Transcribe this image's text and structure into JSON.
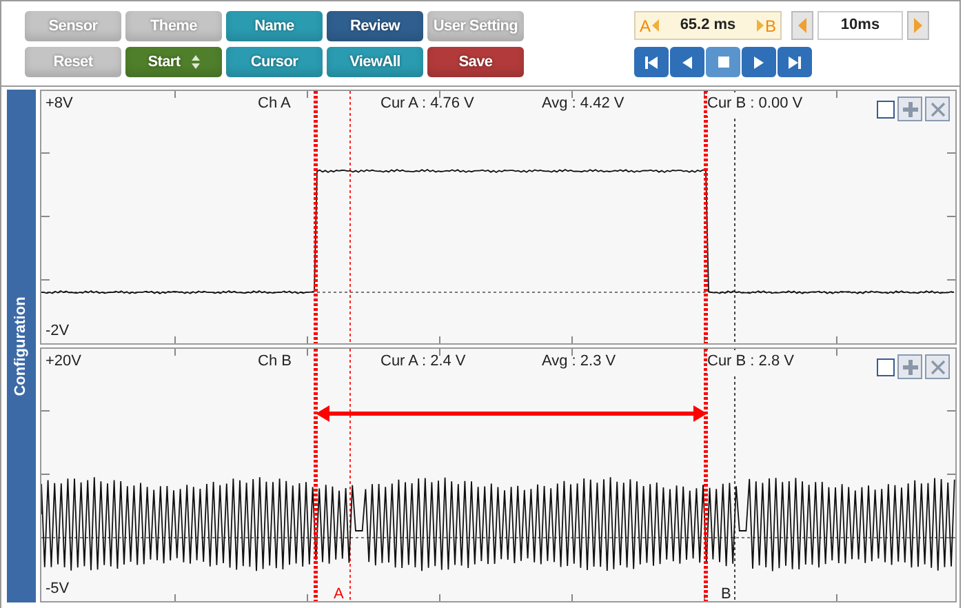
{
  "toolbar": {
    "rows": [
      [
        {
          "label": "Sensor",
          "color": "#c4c4c4",
          "kind": "plain"
        },
        {
          "label": "Theme",
          "color": "#c4c4c4",
          "kind": "plain"
        },
        {
          "label": "Name",
          "color": "#2a9bb0",
          "kind": "plain"
        },
        {
          "label": "Review",
          "color": "#2f5f8f",
          "kind": "plain"
        },
        {
          "label": "User Setting",
          "color": "#c4c4c4",
          "kind": "plain"
        }
      ],
      [
        {
          "label": "Reset",
          "color": "#c4c4c4",
          "kind": "plain"
        },
        {
          "label": "Start",
          "color": "#4f7f2a",
          "kind": "spinner"
        },
        {
          "label": "Cursor",
          "color": "#2a9bb0",
          "kind": "plain"
        },
        {
          "label": "ViewAll",
          "color": "#2a9bb0",
          "kind": "plain"
        },
        {
          "label": "Save",
          "color": "#b23a3a",
          "kind": "plain"
        }
      ]
    ]
  },
  "cursor_readout": {
    "a_label": "A",
    "value": "65.2 ms",
    "b_label": "B"
  },
  "time_scale": {
    "value": "10ms"
  },
  "transport": [
    {
      "kind": "first"
    },
    {
      "kind": "prev"
    },
    {
      "kind": "stop"
    },
    {
      "kind": "next"
    },
    {
      "kind": "last"
    }
  ],
  "side_tab": {
    "label": "Configuration"
  },
  "channels": [
    {
      "top": "+8V",
      "bottom": "-2V",
      "name": "Ch A",
      "cur_a": "Cur A : 4.76 V",
      "avg": "Avg : 4.42 V",
      "cur_b": "Cur B : 0.00 V",
      "checked": false,
      "kind": "pulse",
      "span_arrow": false
    },
    {
      "top": "+20V",
      "bottom": "-5V",
      "name": "Ch B",
      "cur_a": "Cur A : 2.4 V",
      "avg": "Avg : 2.3 V",
      "cur_b": "Cur B : 2.8 V",
      "checked": false,
      "kind": "oscillation",
      "span_arrow": true,
      "marker_a": "A",
      "marker_b": "B"
    }
  ]
}
